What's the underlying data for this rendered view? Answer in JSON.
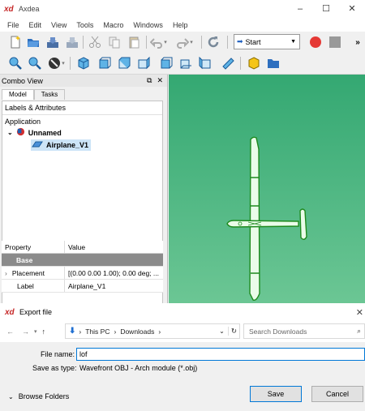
{
  "window": {
    "logo": "xd",
    "title": "Axdea",
    "controls": [
      "–",
      "☐",
      "✕"
    ]
  },
  "menu": [
    "File",
    "Edit",
    "View",
    "Tools",
    "Macro",
    "Windows",
    "Help"
  ],
  "toolbar": {
    "macro_selected": "Start",
    "more": "»"
  },
  "combo_view": {
    "title": "Combo View",
    "tabs": [
      "Model",
      "Tasks"
    ],
    "labels_attributes": "Labels & Attributes",
    "application": "Application",
    "document": "Unnamed",
    "object": "Airplane_V1"
  },
  "properties": {
    "headers": [
      "Property",
      "Value"
    ],
    "group": "Base",
    "rows": [
      {
        "name": "Placement",
        "value": "[(0.00 0.00 1.00); 0.00 deg; ..."
      },
      {
        "name": "Label",
        "value": "Airplane_V1"
      }
    ]
  },
  "dialog": {
    "logo": "xd",
    "title": "Export file",
    "path": [
      "This PC",
      "Downloads"
    ],
    "search_placeholder": "Search Downloads",
    "file_name_label": "File name:",
    "file_name_value": "lof",
    "save_type_label": "Save as type:",
    "save_type_value": "Wavefront OBJ - Arch module (*.obj)",
    "browse_folders": "Browse Folders",
    "save": "Save",
    "cancel": "Cancel"
  },
  "colors": {
    "view_top": "#34a872",
    "view_bottom": "#6dc795",
    "model_stroke": "#1e8a1e",
    "model_fill": "#eafce9",
    "record_red": "#e53935",
    "accent_blue": "#0078d7"
  }
}
